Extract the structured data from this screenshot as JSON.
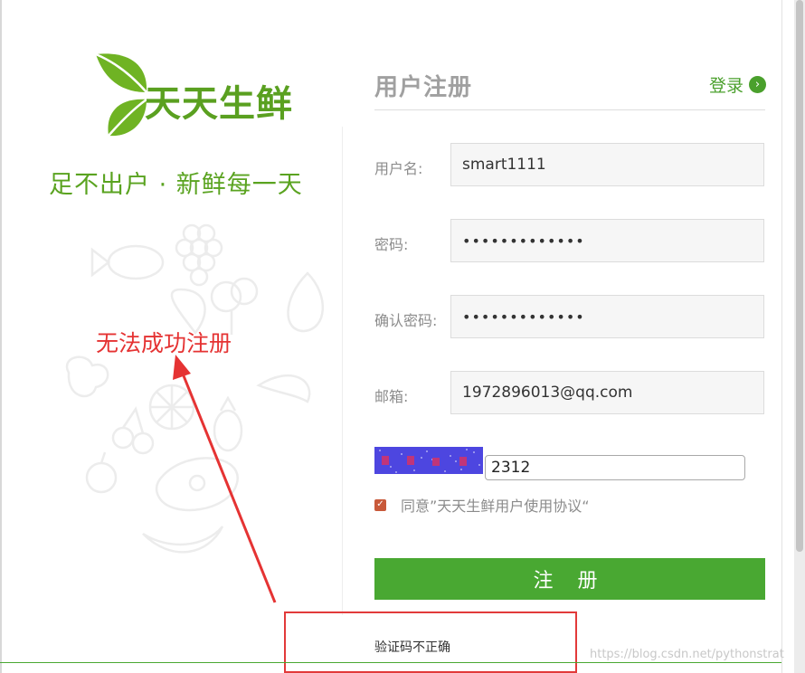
{
  "brand": {
    "logo_text": "天天生鲜",
    "slogan": "足不出户 · 新鲜每一天"
  },
  "annotation": {
    "text": "无法成功注册"
  },
  "form": {
    "title": "用户注册",
    "login_link": "登录",
    "fields": {
      "username": {
        "label": "用户名:",
        "value": "smart1111"
      },
      "password": {
        "label": "密码:",
        "value": "•••••••••••••"
      },
      "confirm": {
        "label": "确认密码:",
        "value": "•••••••••••••"
      },
      "email": {
        "label": "邮箱:",
        "value": "1972896013@qq.com"
      }
    },
    "captcha": {
      "value": "2312"
    },
    "agreement": {
      "text": "同意”天天生鲜用户使用协议“",
      "checked": true
    },
    "submit_label": "注 册",
    "error_message": "验证码不正确"
  },
  "watermark": "https://blog.csdn.net/pythonstrat",
  "colors": {
    "brand_green": "#49a832",
    "annotation_red": "#e53333",
    "captcha_bg": "#4d46e0"
  },
  "icons": {
    "login_arrow": "chevron-right-circle-icon",
    "checkbox": "checkbox-checked-icon"
  }
}
